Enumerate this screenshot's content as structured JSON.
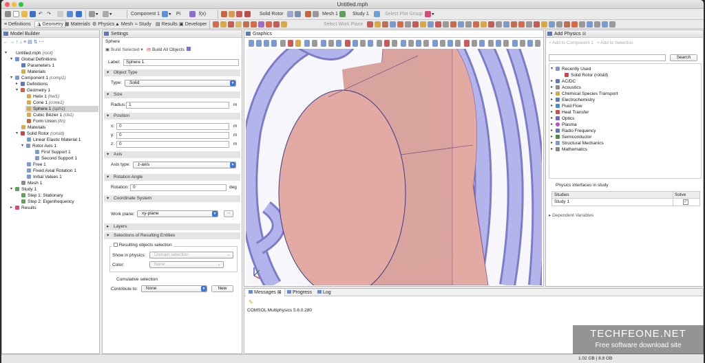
{
  "window": {
    "title": "Untitled.mph"
  },
  "toolbar": {
    "component_label": "Component 1",
    "function_label": "f(x)",
    "pi_label": "Pi",
    "physics_label": "Solid Rotor",
    "mesh_label": "Mesh 1",
    "study_label": "Study 1",
    "plot_group_label": "Select Plot Group"
  },
  "ribbon_tabs": [
    "Definitions",
    "Geometry",
    "Materials",
    "Physics",
    "Mesh",
    "Study",
    "Results",
    "Developer"
  ],
  "ribbon_right": {
    "work_plane": "Select Work Plane"
  },
  "model_builder": {
    "title": "Model Builder",
    "nodes": [
      {
        "label": "Untitled.mph",
        "tag": "(root)"
      },
      {
        "label": "Global Definitions",
        "tag": ""
      },
      {
        "label": "Parameters 1",
        "tag": ""
      },
      {
        "label": "Materials",
        "tag": ""
      },
      {
        "label": "Component 1",
        "tag": "(comp1)"
      },
      {
        "label": "Definitions",
        "tag": ""
      },
      {
        "label": "Geometry 1",
        "tag": ""
      },
      {
        "label": "Helix 1",
        "tag": "(hel1)"
      },
      {
        "label": "Cone 1",
        "tag": "(cone1)"
      },
      {
        "label": "Sphere 1",
        "tag": "(sph1)"
      },
      {
        "label": "Cubic Bézier 1",
        "tag": "(cb1)"
      },
      {
        "label": "Form Union",
        "tag": "(fin)"
      },
      {
        "label": "Materials",
        "tag": ""
      },
      {
        "label": "Solid Rotor",
        "tag": "(rotsld)"
      },
      {
        "label": "Linear Elastic Material 1",
        "tag": ""
      },
      {
        "label": "Rotor Axis 1",
        "tag": ""
      },
      {
        "label": "First Support 1",
        "tag": ""
      },
      {
        "label": "Second Support 1",
        "tag": ""
      },
      {
        "label": "Free 1",
        "tag": ""
      },
      {
        "label": "Fixed Axial Rotation 1",
        "tag": ""
      },
      {
        "label": "Initial Values 1",
        "tag": ""
      },
      {
        "label": "Mesh 1",
        "tag": ""
      },
      {
        "label": "Study 1",
        "tag": ""
      },
      {
        "label": "Step 1: Stationary",
        "tag": ""
      },
      {
        "label": "Step 2: Eigenfrequency",
        "tag": ""
      },
      {
        "label": "Results",
        "tag": ""
      }
    ]
  },
  "settings": {
    "title": "Settings",
    "subtitle": "Sphere",
    "build_selected": "Build Selected",
    "build_all": "Build All Objects",
    "label_label": "Label:",
    "label_value": "Sphere 1",
    "sections": {
      "object_type": "Object Type",
      "size": "Size",
      "position": "Position",
      "axis": "Axis",
      "rotation_angle": "Rotation Angle",
      "coordinate_system": "Coordinate System",
      "layers": "Layers",
      "selections": "Selections of Resulting Entities"
    },
    "type_label": "Type:",
    "type_value": "Solid",
    "radius_label": "Radius:",
    "radius_value": "1",
    "radius_unit": "m",
    "x_label": "x:",
    "x_value": "0",
    "y_label": "y:",
    "y_value": "0",
    "z_label": "z:",
    "z_value": "0",
    "pos_unit": "m",
    "axis_type_label": "Axis type:",
    "axis_type_value": "z-axis",
    "rotation_label": "Rotation:",
    "rotation_value": "0",
    "rotation_unit": "deg",
    "work_plane_label": "Work plane:",
    "work_plane_value": "xy-plane",
    "resulting_objects": "Resulting objects selection",
    "show_in_physics_label": "Show in physics:",
    "show_in_physics_value": "Domain selection",
    "color_label": "Color:",
    "color_value": "None",
    "cumulative": "Cumulative selection",
    "contribute_label": "Contribute to:",
    "contribute_value": "None",
    "new_button": "New"
  },
  "graphics": {
    "title": "Graphics"
  },
  "messages": {
    "tabs": [
      "Messages",
      "Progress",
      "Log"
    ],
    "text": "COMSOL Multiphysics 5.6.0.280"
  },
  "add_physics": {
    "title": "Add Physics",
    "add_to_component": "Add to Component 1",
    "add_to_selection": "Add to Selection",
    "search_button": "Search",
    "items": [
      {
        "label": "Recently Used",
        "expanded": true
      },
      {
        "label": "Solid Rotor (rotsld)",
        "child": true
      },
      {
        "label": "AC/DC"
      },
      {
        "label": "Acoustics"
      },
      {
        "label": "Chemical Species Transport"
      },
      {
        "label": "Electrochemistry"
      },
      {
        "label": "Fluid Flow"
      },
      {
        "label": "Heat Transfer"
      },
      {
        "label": "Optics"
      },
      {
        "label": "Plasma"
      },
      {
        "label": "Radio Frequency"
      },
      {
        "label": "Semiconductor"
      },
      {
        "label": "Structural Mechanics"
      },
      {
        "label": "Mathematics"
      }
    ],
    "interfaces_title": "Physics interfaces in study",
    "col_studies": "Studies",
    "col_solve": "Solve",
    "study_row": "Study 1",
    "dependent_variables": "Dependent Variables"
  },
  "status_bar": {
    "memory": "1.02 GB | 8.8 GB"
  },
  "watermark": {
    "site": "TECHFEONE.NET",
    "tagline": "Free software download site"
  },
  "colors": {
    "model_bg": "#a9a9ec",
    "coil": "#9a9ada",
    "body": "#e3aaa4",
    "accent": "#3a76d8"
  }
}
